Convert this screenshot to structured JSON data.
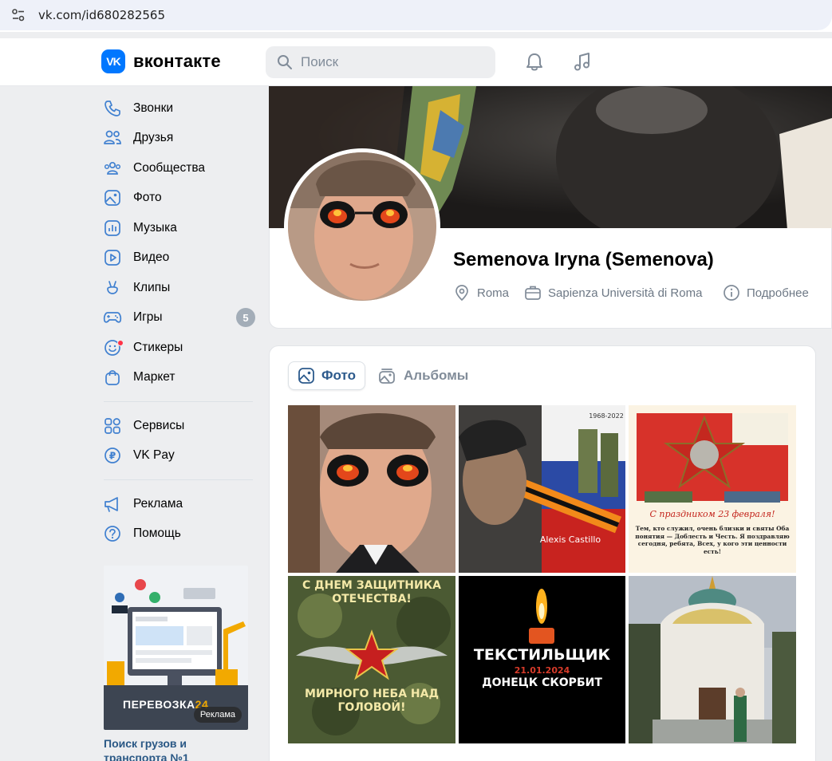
{
  "browser": {
    "url": "vk.com/id680282565"
  },
  "header": {
    "logo_mark": "VK",
    "logo_text": "вконтакте",
    "search_placeholder": "Поиск"
  },
  "menu": {
    "items": [
      {
        "label": "Звонки",
        "icon": "phone-icon"
      },
      {
        "label": "Друзья",
        "icon": "friends-icon"
      },
      {
        "label": "Сообщества",
        "icon": "communities-icon"
      },
      {
        "label": "Фото",
        "icon": "photo-icon"
      },
      {
        "label": "Музыка",
        "icon": "music-icon"
      },
      {
        "label": "Видео",
        "icon": "video-icon"
      },
      {
        "label": "Клипы",
        "icon": "clips-icon"
      },
      {
        "label": "Игры",
        "icon": "games-icon",
        "badge": "5"
      },
      {
        "label": "Стикеры",
        "icon": "stickers-icon"
      },
      {
        "label": "Маркет",
        "icon": "market-icon"
      }
    ],
    "services": [
      {
        "label": "Сервисы",
        "icon": "services-icon"
      },
      {
        "label": "VK Pay",
        "icon": "vkpay-icon"
      }
    ],
    "other": [
      {
        "label": "Реклама",
        "icon": "ads-icon"
      },
      {
        "label": "Помощь",
        "icon": "help-icon"
      }
    ]
  },
  "ad": {
    "brand": "ПЕРЕВОЗКА",
    "brand_number": "24",
    "label": "Реклама",
    "title": "Поиск грузов и транспорта №1"
  },
  "profile": {
    "name": "Semenova Iryna (Semenova)",
    "city": "Roma",
    "university": "Sapienza Università di Roma",
    "more": "Подробнее"
  },
  "photos": {
    "tab_photos": "Фото",
    "tab_albums": "Альбомы",
    "tile_texts": {
      "t2_years": "1968-2022",
      "t2_signature": "Alexis Castillo",
      "t3_greeting": "С праздником 23 февраля!",
      "t3_verse": "Тем, кто служил, очень близки и святы Оба понятия — Доблесть и Честь. Я поздравляю сегодня, ребята, Всех, у кого эти ценности есть!",
      "t4_top": "С ДНЕМ ЗАЩИТНИКА ОТЕЧЕСТВА!",
      "t4_bottom": "МИРНОГО НЕБА НАД ГОЛОВОЙ!",
      "t5_title": "ТЕКСТИЛЬЩИК",
      "t5_date": "21.01.2024",
      "t5_sub": "ДОНЕЦК СКОРБИТ"
    }
  }
}
